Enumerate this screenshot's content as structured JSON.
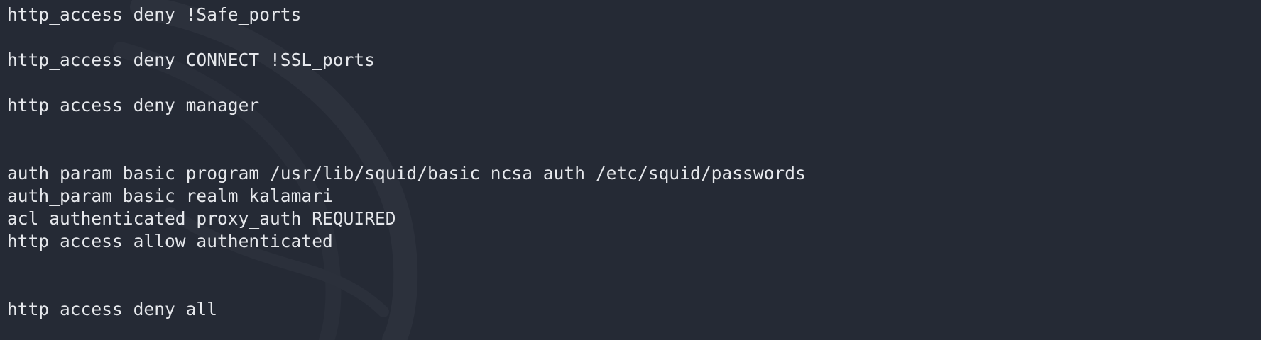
{
  "terminal": {
    "lines": [
      "http_access deny !Safe_ports",
      "",
      "http_access deny CONNECT !SSL_ports",
      "",
      "http_access deny manager",
      "",
      "",
      "auth_param basic program /usr/lib/squid/basic_ncsa_auth /etc/squid/passwords",
      "auth_param basic realm kalamari",
      "acl authenticated proxy_auth REQUIRED",
      "http_access allow authenticated",
      "",
      "",
      "http_access deny all"
    ]
  },
  "colors": {
    "background": "#252a35",
    "text": "#e6e8ec",
    "watermark": "#2d323d"
  },
  "icons": {
    "watermark": "kali-dragon-watermark-icon"
  }
}
